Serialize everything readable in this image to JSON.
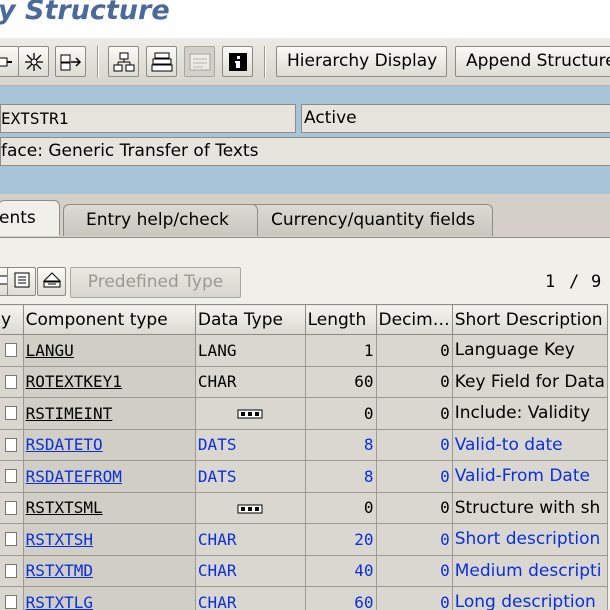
{
  "window": {
    "title": "y Structure"
  },
  "toolbar": {
    "hierarchy_label": "Hierarchy Display",
    "append_label": "Append Structure",
    "icons": [
      "activate-icon",
      "where-used-icon",
      "navigate-icon",
      "hierarchy-icon",
      "structure-icon",
      "documentation-icon",
      "info-icon"
    ]
  },
  "header": {
    "name": "EXTSTR1",
    "status": "Active",
    "description": "face: Generic Transfer of Texts"
  },
  "tabs": [
    {
      "label": "ents",
      "active": true
    },
    {
      "label": "Entry help/check",
      "active": false
    },
    {
      "label": "Currency/quantity fields",
      "active": false
    }
  ],
  "components_toolbar": {
    "predefined_type_label": "Predefined Type",
    "page_current": "1",
    "page_sep": "/",
    "page_total": "9"
  },
  "grid": {
    "columns": [
      "y",
      "Component type",
      "Data Type",
      "Length",
      "Decim…",
      "Short Description"
    ],
    "rows": [
      {
        "component_type": "LANGU",
        "data_type": "LANG",
        "length": "1",
        "decimals": "0",
        "description": "Language Key",
        "link": false,
        "include": false
      },
      {
        "component_type": "ROTEXTKEY1",
        "data_type": "CHAR",
        "length": "60",
        "decimals": "0",
        "description": "Key Field for Data",
        "link": false,
        "include": false
      },
      {
        "component_type": "RSTIMEINT",
        "data_type": "",
        "length": "0",
        "decimals": "0",
        "description": "Include: Validity",
        "link": false,
        "include": true
      },
      {
        "component_type": "RSDATETO",
        "data_type": "DATS",
        "length": "8",
        "decimals": "0",
        "description": "Valid-to date",
        "link": true,
        "include": false
      },
      {
        "component_type": "RSDATEFROM",
        "data_type": "DATS",
        "length": "8",
        "decimals": "0",
        "description": "Valid-From Date",
        "link": true,
        "include": false
      },
      {
        "component_type": "RSTXTSML",
        "data_type": "",
        "length": "0",
        "decimals": "0",
        "description": "Structure with sh",
        "link": false,
        "include": true
      },
      {
        "component_type": "RSTXTSH",
        "data_type": "CHAR",
        "length": "20",
        "decimals": "0",
        "description": "Short description",
        "link": true,
        "include": false
      },
      {
        "component_type": "RSTXTMD",
        "data_type": "CHAR",
        "length": "40",
        "decimals": "0",
        "description": "Medium descripti",
        "link": true,
        "include": false
      },
      {
        "component_type": "RSTXTLG",
        "data_type": "CHAR",
        "length": "60",
        "decimals": "0",
        "description": "Long description",
        "link": true,
        "include": false
      }
    ]
  },
  "colors": {
    "title": "#4a6a9c",
    "header_band": "#a8c4d9",
    "link": "#0a2fdc",
    "background": "#d4d0c8"
  }
}
